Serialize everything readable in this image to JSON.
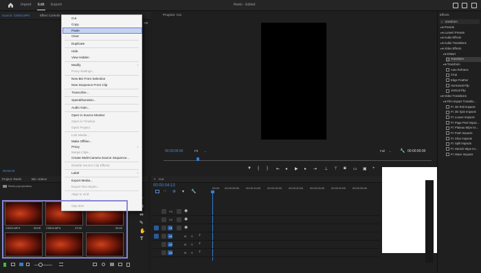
{
  "topbar": {
    "tabs": [
      "Import",
      "Edit",
      "Export"
    ],
    "active_tab": "Edit",
    "project_title": "Reels - Edited"
  },
  "source_panel": {
    "tabs": [
      "Source: C0002.MP4",
      "Effect Controls"
    ],
    "clip_name": "Source: C0002.MP4",
    "timecode_right": ":00",
    "timecode_bottom": "00:00:22"
  },
  "context_menu": {
    "items": [
      {
        "label": "Cut",
        "disabled": false
      },
      {
        "label": "Copy",
        "disabled": false
      },
      {
        "label": "Paste",
        "disabled": false,
        "highlighted": true
      },
      {
        "label": "Clear",
        "disabled": false
      },
      {
        "label": "Duplicate",
        "disabled": false
      },
      {
        "label": "Hide",
        "disabled": false
      },
      {
        "label": "View Hidden",
        "disabled": false
      },
      {
        "label": "Modify",
        "disabled": false,
        "submenu": true
      },
      {
        "label": "Proxy Settings...",
        "disabled": true
      },
      {
        "label": "New Bin From Selection",
        "disabled": false
      },
      {
        "label": "New Sequence From Clip",
        "disabled": false
      },
      {
        "label": "Transcribe...",
        "disabled": false
      },
      {
        "label": "Speed/Duration...",
        "disabled": false
      },
      {
        "label": "Audio Gain...",
        "disabled": false
      },
      {
        "label": "Open in Source Monitor",
        "disabled": false
      },
      {
        "label": "Open in Timeline",
        "disabled": true
      },
      {
        "label": "Open Project",
        "disabled": true
      },
      {
        "label": "Link Media...",
        "disabled": true
      },
      {
        "label": "Make Offline...",
        "disabled": false
      },
      {
        "label": "Proxy",
        "disabled": false,
        "submenu": true
      },
      {
        "label": "Merge Clips...",
        "disabled": true
      },
      {
        "label": "Create Multi-Camera Source Sequence...",
        "disabled": false
      },
      {
        "label": "Disable Source Clip Effects",
        "disabled": true
      },
      {
        "label": "Label",
        "disabled": false,
        "submenu": true
      },
      {
        "label": "Export Media...",
        "disabled": false
      },
      {
        "label": "Export Text Styles...",
        "disabled": true
      },
      {
        "label": "Align to Grid",
        "disabled": true
      },
      {
        "label": "Reset to Grid",
        "disabled": true
      },
      {
        "label": "Clip Size",
        "disabled": true
      }
    ]
  },
  "project_panel": {
    "tabs": [
      "Project: Reels",
      "Bin: videos"
    ],
    "path": "Reels.prproj\\videos",
    "clips": [
      {
        "name": "C0002.MP4",
        "duration": "39:09"
      },
      {
        "name": "C0004.MP4",
        "duration": "47:02"
      },
      {
        "name": "",
        "duration": "04:02"
      },
      {
        "name": "",
        "duration": ""
      },
      {
        "name": "",
        "duration": ""
      },
      {
        "name": "",
        "duration": ""
      }
    ]
  },
  "program_monitor": {
    "title": "Program: Cut",
    "timecode_left": "00:00:00:00",
    "fit": "Fit",
    "quality": "Full",
    "timecode_right": "00:00:00:00"
  },
  "timeline": {
    "tab": "Cut",
    "timecode": "00:00:04:13",
    "ruler": [
      "00:00",
      "00:00:05:00",
      "00:00:10:00",
      "00:00:15:00",
      "00:00:20:00",
      "00:00:25:00",
      "00:00:30:00",
      "00:00:35:00"
    ],
    "video_tracks": [
      "V3",
      "V2",
      "V1"
    ],
    "audio_tracks": [
      "A1",
      "A2",
      "A3"
    ],
    "audio_letters": [
      "M",
      "S"
    ]
  },
  "effects_panel": {
    "title": "Effects",
    "search": "transform",
    "tree": [
      {
        "label": "Presets",
        "indent": 1,
        "type": "folder"
      },
      {
        "label": "Lumetri Presets",
        "indent": 1,
        "type": "folder"
      },
      {
        "label": "Audio Effects",
        "indent": 1,
        "type": "folder"
      },
      {
        "label": "Audio Transitions",
        "indent": 1,
        "type": "folder"
      },
      {
        "label": "Video Effects",
        "indent": 1,
        "type": "folder"
      },
      {
        "label": "Distort",
        "indent": 2,
        "type": "folder"
      },
      {
        "label": "Transform",
        "indent": 3,
        "type": "fx",
        "selected": true
      },
      {
        "label": "Transform",
        "indent": 2,
        "type": "folder"
      },
      {
        "label": "Auto Reframe",
        "indent": 3,
        "type": "fx"
      },
      {
        "label": "Crop",
        "indent": 3,
        "type": "fx"
      },
      {
        "label": "Edge Feather",
        "indent": 3,
        "type": "fx"
      },
      {
        "label": "Horizontal Flip",
        "indent": 3,
        "type": "fx"
      },
      {
        "label": "Vertical Flip",
        "indent": 3,
        "type": "fx"
      },
      {
        "label": "Video Transitions",
        "indent": 1,
        "type": "folder"
      },
      {
        "label": "Film Impact Transitio...",
        "indent": 2,
        "type": "folder"
      },
      {
        "label": "FI: 3D Roll Impacts",
        "indent": 3,
        "type": "fx"
      },
      {
        "label": "FI: 3D Spin Impacts",
        "indent": 3,
        "type": "fx"
      },
      {
        "label": "FI: Louver Impacts",
        "indent": 3,
        "type": "fx"
      },
      {
        "label": "FI: Page Peel Impac...",
        "indent": 3,
        "type": "fx"
      },
      {
        "label": "FI: Plateau Wipe Im...",
        "indent": 3,
        "type": "fx"
      },
      {
        "label": "FI: Push Impacts",
        "indent": 3,
        "type": "fx"
      },
      {
        "label": "FI: Slice Impacts",
        "indent": 3,
        "type": "fx"
      },
      {
        "label": "FI: Split Impacts",
        "indent": 3,
        "type": "fx"
      },
      {
        "label": "FI: Stretch Wipe Im...",
        "indent": 3,
        "type": "fx"
      },
      {
        "label": "FI: Wave Impacts",
        "indent": 3,
        "type": "fx"
      }
    ]
  },
  "colors": {
    "accent_blue": "#2f7fd8",
    "highlight_outline": "#7b78d8",
    "menu_bg": "#f4f4f4"
  }
}
